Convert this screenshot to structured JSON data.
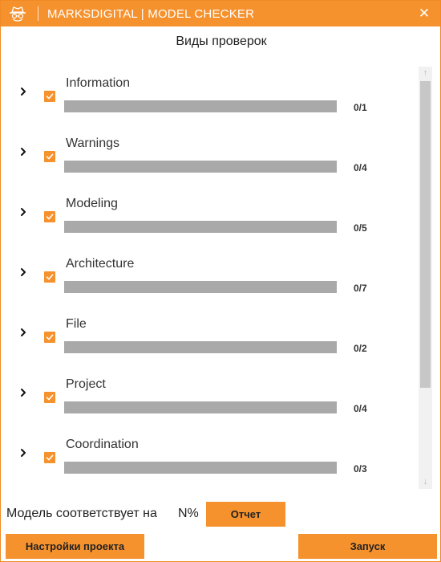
{
  "window": {
    "title": "MARKSDIGITAL | MODEL CHECKER",
    "close_symbol": "✕",
    "app_icon": "spy-hat-icon"
  },
  "heading": "Виды проверок",
  "categories": [
    {
      "label": "Information",
      "count": "0/1",
      "checked": true,
      "progress": 0
    },
    {
      "label": "Warnings",
      "count": "0/4",
      "checked": true,
      "progress": 0
    },
    {
      "label": "Modeling",
      "count": "0/5",
      "checked": true,
      "progress": 0
    },
    {
      "label": "Architecture",
      "count": "0/7",
      "checked": true,
      "progress": 0
    },
    {
      "label": "File",
      "count": "0/2",
      "checked": true,
      "progress": 0
    },
    {
      "label": "Project",
      "count": "0/4",
      "checked": true,
      "progress": 0
    },
    {
      "label": "Coordination",
      "count": "0/3",
      "checked": true,
      "progress": 0
    }
  ],
  "scrollbar": {
    "up": "↑",
    "down": "↓"
  },
  "status": {
    "text": "Модель соответствует на",
    "value": "N%"
  },
  "buttons": {
    "report": "Отчет",
    "settings": "Настройки проекта",
    "run": "Запуск"
  },
  "colors": {
    "accent": "#f5922e",
    "bar_track": "#a9a9a9"
  }
}
